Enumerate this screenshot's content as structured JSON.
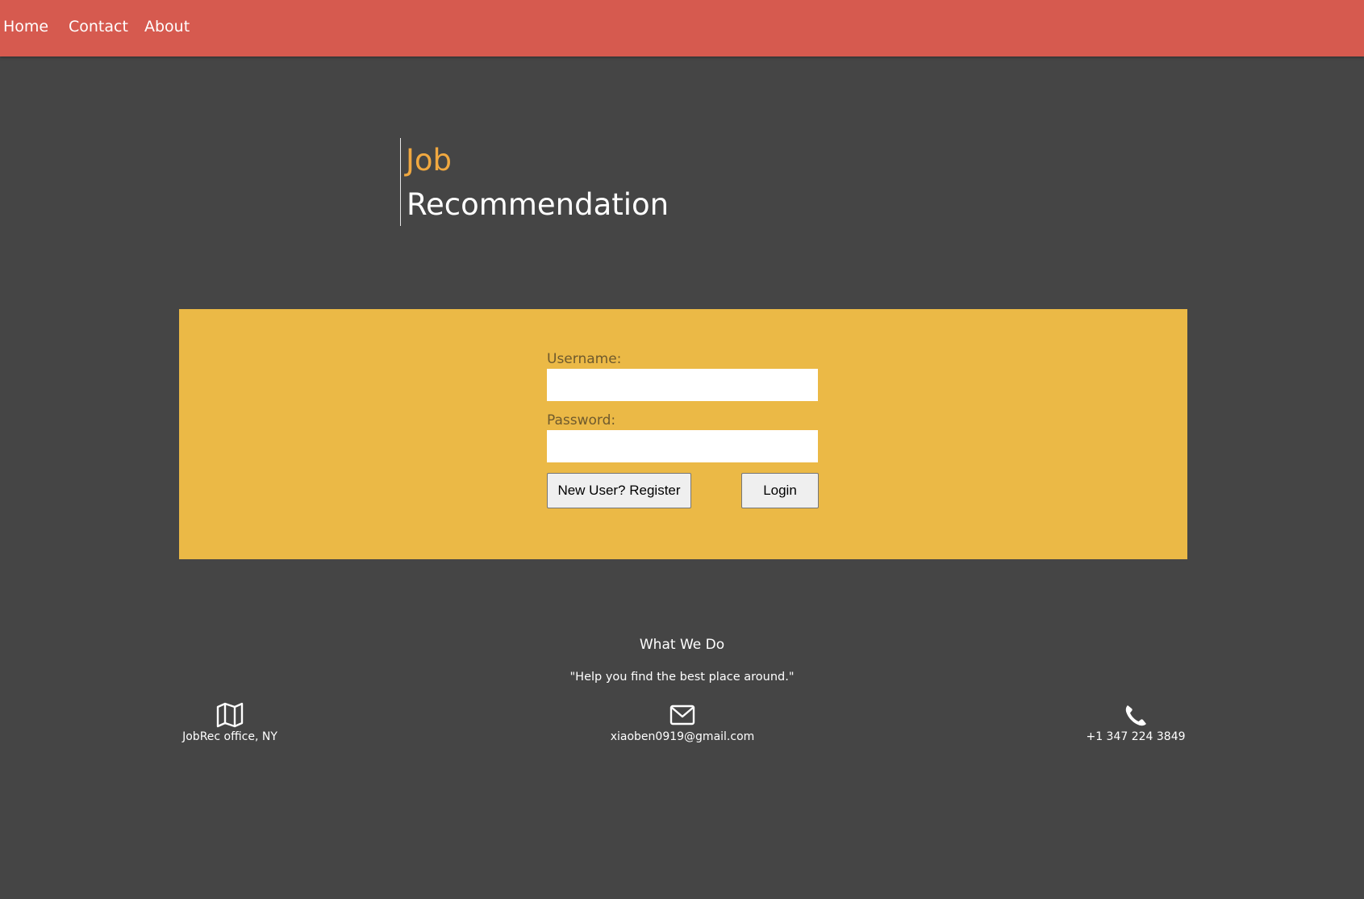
{
  "nav": {
    "items": [
      {
        "label": "Home"
      },
      {
        "label": "Contact"
      },
      {
        "label": "About"
      }
    ]
  },
  "hero": {
    "line1": "Job",
    "line2": "Recommendation"
  },
  "login": {
    "username_label": "Username:",
    "username_value": "",
    "password_label": "Password:",
    "password_value": "",
    "register_label": "New User? Register",
    "login_label": "Login"
  },
  "about": {
    "title": "What We Do",
    "quote": "\"Help you find the best place around.\""
  },
  "contacts": [
    {
      "icon": "map-icon",
      "text": "JobRec office, NY"
    },
    {
      "icon": "envelope-icon",
      "text": "xiaoben0919@gmail.com"
    },
    {
      "icon": "phone-icon",
      "text": "+1 347 224 3849"
    }
  ],
  "colors": {
    "background": "#454545",
    "nav_bar": "#d65a4f",
    "panel": "#ebb946",
    "accent_title": "#f0a840"
  }
}
